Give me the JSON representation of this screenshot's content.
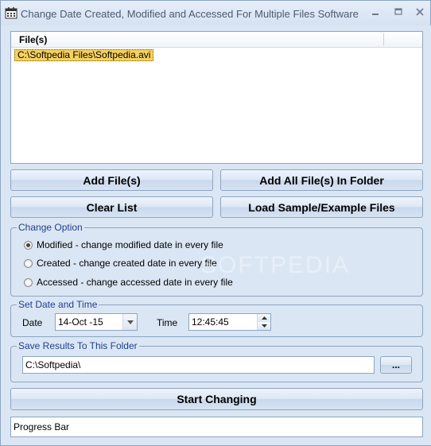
{
  "window": {
    "title": "Change Date Created, Modified and Accessed For Multiple Files Software"
  },
  "file_list": {
    "column_header": "File(s)",
    "rows": [
      "C:\\Softpedia Files\\Softpedia.avi"
    ]
  },
  "buttons": {
    "add_files": "Add File(s)",
    "add_all_in_folder": "Add All File(s) In Folder",
    "clear_list": "Clear List",
    "load_samples": "Load Sample/Example Files",
    "browse": "...",
    "start": "Start Changing"
  },
  "change_option": {
    "label": "Change Option",
    "options": [
      {
        "label": "Modified - change modified date in every file",
        "checked": true
      },
      {
        "label": "Created - change created date in every file",
        "checked": false
      },
      {
        "label": "Accessed - change accessed date in every file",
        "checked": false
      }
    ]
  },
  "date_time": {
    "label": "Set Date and Time",
    "date_label": "Date",
    "date_value": "14-Oct -15",
    "time_label": "Time",
    "time_value": "12:45:45"
  },
  "save_folder": {
    "label": "Save Results To This Folder",
    "path": "C:\\Softpedia\\"
  },
  "progress": {
    "text": "Progress Bar"
  },
  "watermark": "SOFTPEDIA",
  "colors": {
    "background": "#dbe6f4",
    "border": "#8ea4c1",
    "group_label": "#1f3f8c",
    "selection": "#f6d15f"
  }
}
